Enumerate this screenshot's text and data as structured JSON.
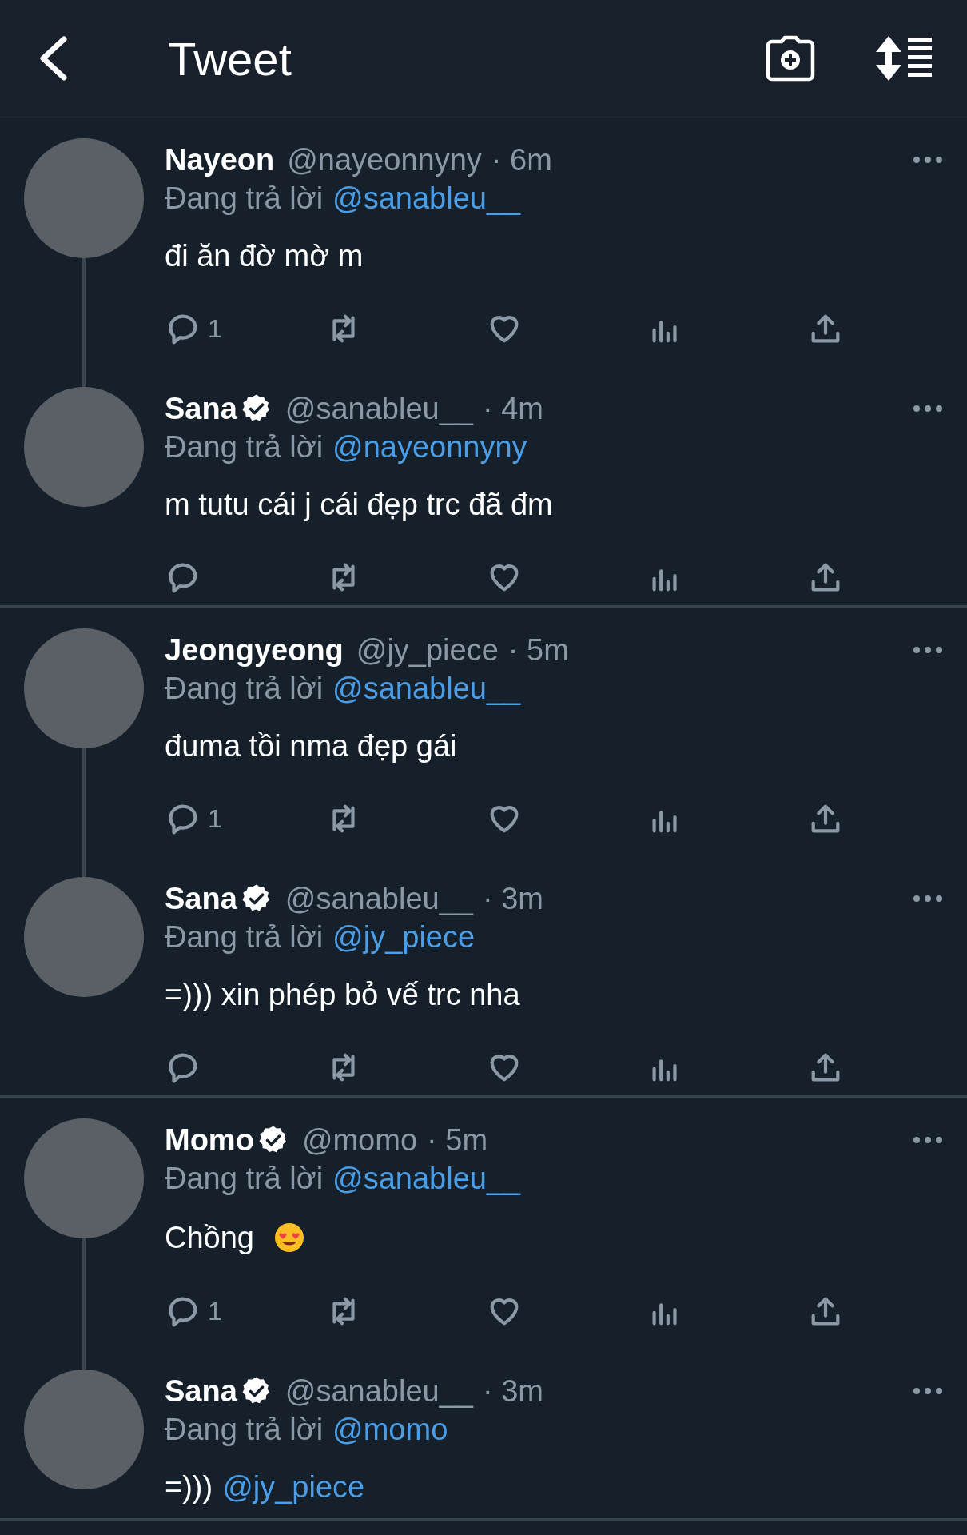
{
  "header": {
    "title": "Tweet"
  },
  "groups": [
    {
      "tweets": [
        {
          "name": "Nayeon",
          "verified": false,
          "handle": "@nayeonnyny",
          "time": "· 6m",
          "reply_label": "Đang trả lời",
          "reply_to": "@sanableu__",
          "text": [
            {
              "kind": "text",
              "text": "đi ăn đờ mờ m"
            }
          ],
          "reply_count": "1",
          "thread_line": true,
          "actions": true
        },
        {
          "name": "Sana",
          "verified": true,
          "handle": "@sanableu__",
          "time": "· 4m",
          "reply_label": "Đang trả lời",
          "reply_to": "@nayeonnyny",
          "text": [
            {
              "kind": "text",
              "text": "m tutu cái j cái đẹp trc đã đm"
            }
          ],
          "thread_line": false,
          "actions": true
        }
      ]
    },
    {
      "tweets": [
        {
          "name": "Jeongyeong",
          "verified": false,
          "handle": "@jy_piece",
          "time": "· 5m",
          "reply_label": "Đang trả lời",
          "reply_to": "@sanableu__",
          "text": [
            {
              "kind": "text",
              "text": "đuma tồi nma đẹp gái"
            }
          ],
          "reply_count": "1",
          "thread_line": true,
          "actions": true
        },
        {
          "name": "Sana",
          "verified": true,
          "handle": "@sanableu__",
          "time": "· 3m",
          "reply_label": "Đang trả lời",
          "reply_to": "@jy_piece",
          "text": [
            {
              "kind": "text",
              "text": "=))) xin phép bỏ vế trc nha"
            }
          ],
          "thread_line": false,
          "actions": true
        }
      ]
    },
    {
      "tweets": [
        {
          "name": "Momo",
          "verified": true,
          "handle": "@momo",
          "time": "· 5m",
          "reply_label": "Đang trả lời",
          "reply_to": "@sanableu__",
          "text": [
            {
              "kind": "text",
              "text": "Chồng"
            },
            {
              "kind": "emoji"
            }
          ],
          "reply_count": "1",
          "thread_line": true,
          "actions": true
        },
        {
          "name": "Sana",
          "verified": true,
          "handle": "@sanableu__",
          "time": "· 3m",
          "reply_label": "Đang trả lời",
          "reply_to": "@momo",
          "text": [
            {
              "kind": "text",
              "text": "=)))"
            },
            {
              "kind": "mention",
              "text": "@jy_piece"
            }
          ],
          "thread_line": false,
          "actions": false
        }
      ]
    }
  ]
}
